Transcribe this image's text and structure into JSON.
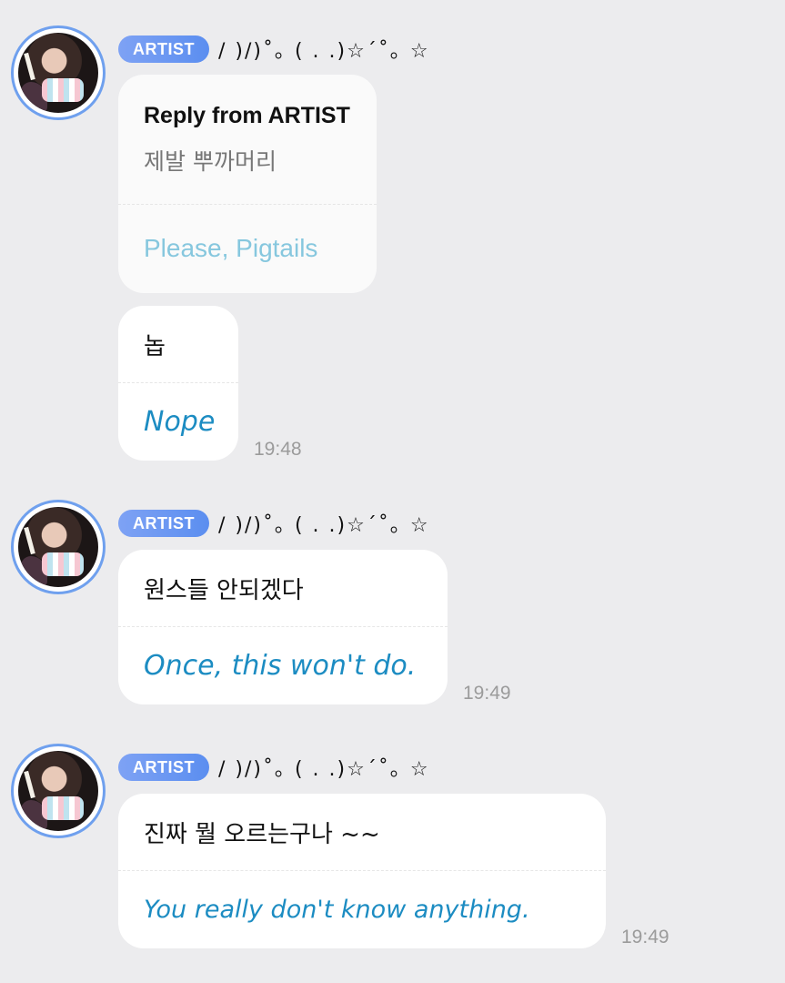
{
  "messages": [
    {
      "badge": "ARTIST",
      "nickname": "/ )/)˚｡ ( . .)☆´˚｡ ☆",
      "reply": {
        "title": "Reply from ARTIST",
        "text": "제발 뿌까머리",
        "translation": "Please, Pigtails"
      },
      "text": "놉",
      "translation": "Nope",
      "time": "19:48"
    },
    {
      "badge": "ARTIST",
      "nickname": "/ )/)˚｡ ( . .)☆´˚｡ ☆",
      "text": "원스들 안되겠다",
      "translation": "Once, this won't do.",
      "time": "19:49"
    },
    {
      "badge": "ARTIST",
      "nickname": "/ )/)˚｡ ( . .)☆´˚｡ ☆",
      "text": "진짜 뭘 오르는구나 ~~",
      "translation": "You really don't know anything.",
      "time": "19:49"
    }
  ],
  "colors": {
    "background": "#ececee",
    "badge": "#5b8ef0",
    "translation": "#1c8cc2",
    "reply_translation": "#86c7de"
  }
}
